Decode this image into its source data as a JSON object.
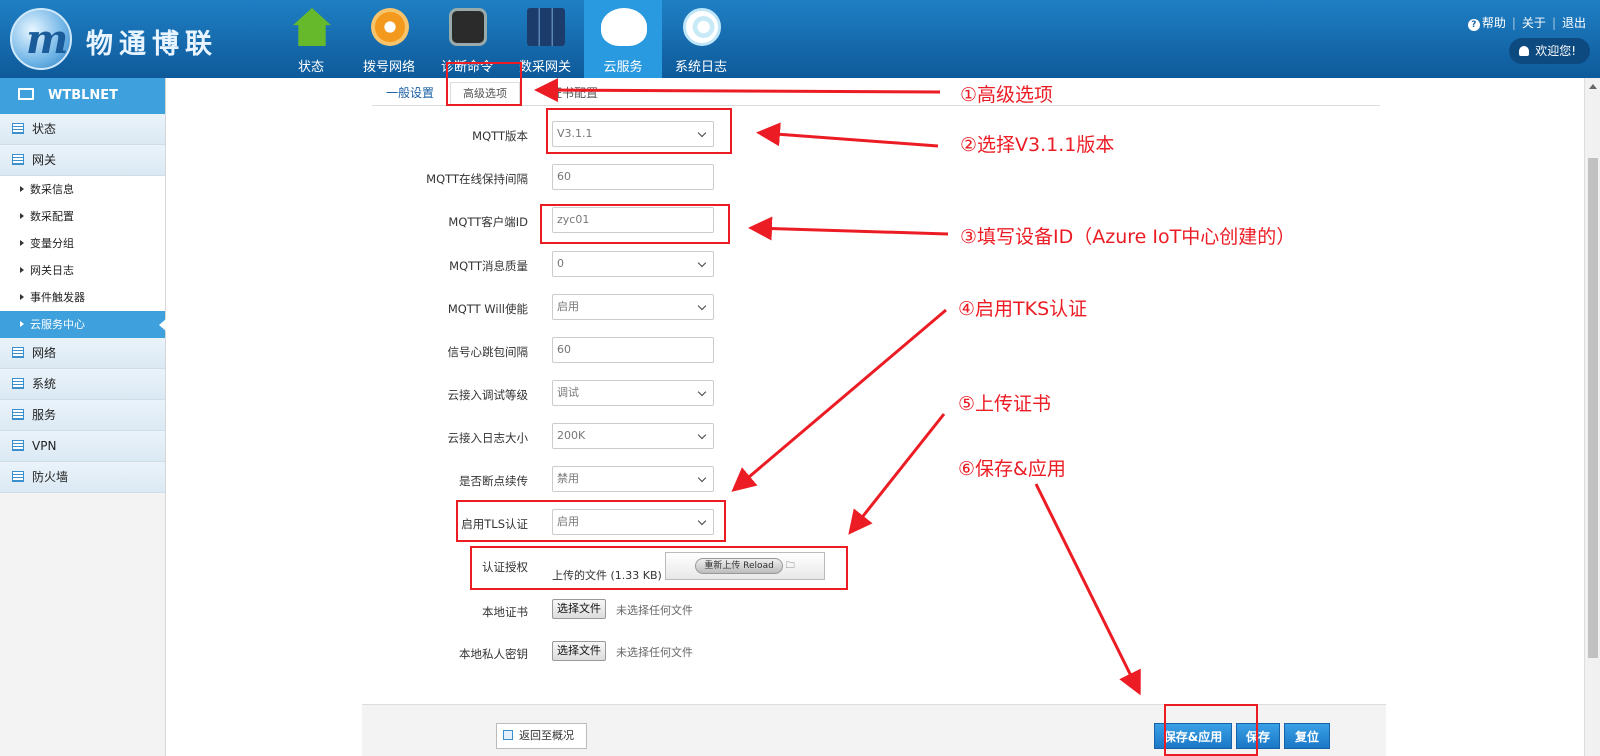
{
  "header": {
    "logo_mark": "m",
    "logo_text": "物通博联",
    "nav": [
      {
        "label": "状态",
        "icon": "home-icon"
      },
      {
        "label": "拨号网络",
        "icon": "dial-icon"
      },
      {
        "label": "诊断命令",
        "icon": "terminal-icon"
      },
      {
        "label": "数采网关",
        "icon": "gateway-icon"
      },
      {
        "label": "云服务",
        "icon": "cloud-icon",
        "active": true
      },
      {
        "label": "系统日志",
        "icon": "stethoscope-icon"
      }
    ],
    "help": "帮助",
    "about": "关于",
    "logout": "退出",
    "welcome": "欢迎您!"
  },
  "sidebar": {
    "title": "WTBLNET",
    "groups_top": [
      "状态",
      "网关"
    ],
    "sub_items": [
      "数采信息",
      "数采配置",
      "变量分组",
      "网关日志",
      "事件触发器",
      "云服务中心"
    ],
    "active_sub": "云服务中心",
    "groups_bottom": [
      "网络",
      "系统",
      "服务",
      "VPN",
      "防火墙"
    ]
  },
  "tabs": {
    "general": "一般设置",
    "advanced": "高级选项",
    "ghost": "证书配置"
  },
  "form": {
    "mqtt_version": {
      "label": "MQTT版本",
      "value": "V3.1.1"
    },
    "keepalive": {
      "label": "MQTT在线保持间隔",
      "value": "60"
    },
    "client_id": {
      "label": "MQTT客户端ID",
      "value": "zyc01"
    },
    "qos": {
      "label": "MQTT消息质量",
      "value": "0"
    },
    "will": {
      "label": "MQTT Will使能",
      "value": "启用"
    },
    "heartbeat": {
      "label": "信号心跳包间隔",
      "value": "60"
    },
    "debug_level": {
      "label": "云接入调试等级",
      "value": "调试"
    },
    "log_size": {
      "label": "云接入日志大小",
      "value": "200K"
    },
    "resume": {
      "label": "是否断点续传",
      "value": "禁用"
    },
    "tls": {
      "label": "启用TLS认证",
      "value": "启用"
    },
    "ca": {
      "label": "认证授权",
      "uploaded": "上传的文件 (1.33 KB)",
      "reload": "重新上传 Reload"
    },
    "local_cert": {
      "label": "本地证书",
      "button": "选择文件",
      "status": "未选择任何文件"
    },
    "local_key": {
      "label": "本地私人密钥",
      "button": "选择文件",
      "status": "未选择任何文件"
    }
  },
  "footer": {
    "back": "返回至概况",
    "save_apply": "保存&应用",
    "save": "保存",
    "reset": "复位"
  },
  "annotations": {
    "a1": "①高级选项",
    "a2": "②选择V3.1.1版本",
    "a3": "③填写设备ID（Azure IoT中心创建的）",
    "a4": "④启用TKS认证",
    "a5": "⑤上传证书",
    "a6": "⑥保存&应用"
  },
  "colors": {
    "header_blue": "#1a6fb5",
    "active_blue": "#3ea0dc",
    "annotation_red": "#ec1c24"
  }
}
